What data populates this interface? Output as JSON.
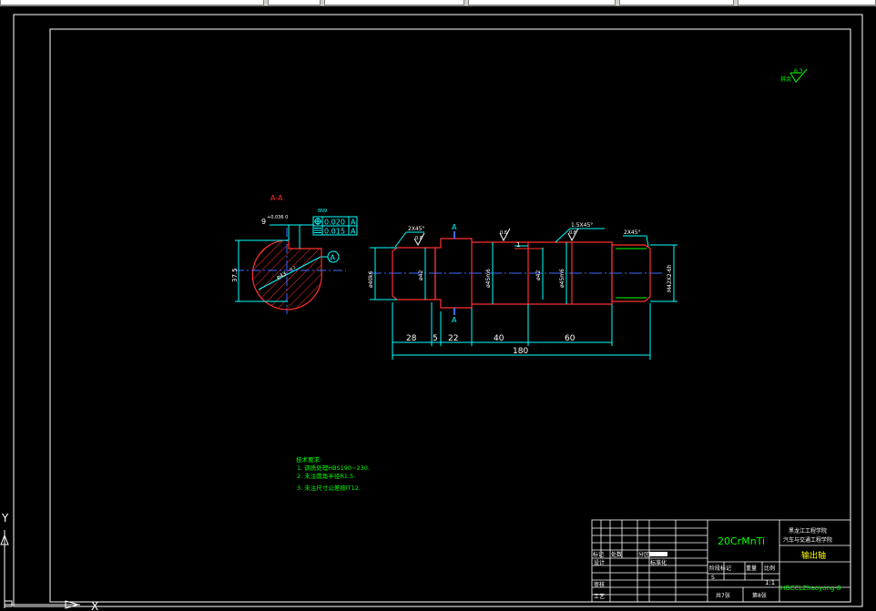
{
  "section_label": "A-A",
  "section_marker": "A",
  "datum_marker": "A",
  "section_view": {
    "keyway_width": "9",
    "keyway_tol": "+0.036\n0",
    "tol_label": "8N9",
    "fcf1_value": "0.020",
    "fcf1_datum": "A",
    "fcf2_value": "0.015",
    "fcf2_datum": "A",
    "dia_label": "ø43",
    "dia_tol": "-0.2",
    "height_label": "37.5"
  },
  "shaft": {
    "chamfer_left": "2X45°",
    "chamfer_mid": "1.5X45°",
    "chamfer_right": "2X45°",
    "dims": [
      "28",
      "5",
      "22",
      "40",
      "60"
    ],
    "overall": "180",
    "d1": "ø40k6",
    "d2": "ø42",
    "d3": "ø45m6",
    "d4": "ø42",
    "d5": "ø45m6",
    "thread": "M42X2-6h",
    "roughness": [
      "0.8",
      "0.8",
      "0.8"
    ],
    "keyway_depth": "1"
  },
  "roughness_note": {
    "text": "其余",
    "value": "6.3"
  },
  "notes": {
    "title": "技术要求:",
    "items": [
      "1. 调质处理HBS190~230.",
      "2. 未注圆角半径R1.5.",
      "3. 未注尺寸公差按IT12."
    ]
  },
  "title_block": {
    "material": "20CrMnTi",
    "school_line1": "黑龙江工程学院",
    "school_line2": "汽车与交通工程学院",
    "part_name": "输出轴",
    "drawing_no": "HGCCLZhaoyong-8",
    "row_labels": [
      "标记",
      "处数",
      "分区"
    ],
    "design": "设计",
    "standard": "标准化",
    "review": "审核",
    "process": "工艺",
    "stage": "阶段标记",
    "weight": "重量",
    "scale_label": "比例",
    "stage_value": "S",
    "scale_value": "1:1",
    "total_sheets": "共7张",
    "sheet_no": "第8张"
  },
  "ucs": {
    "y": "Y",
    "x": "X"
  }
}
